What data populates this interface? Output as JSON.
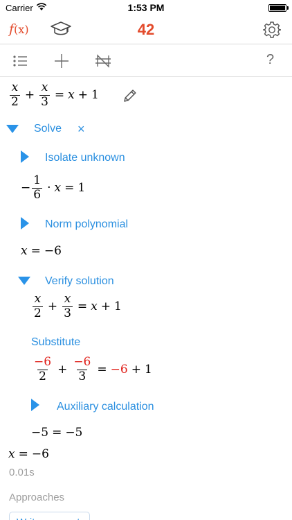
{
  "status_bar": {
    "carrier": "Carrier",
    "time": "1:53 PM"
  },
  "nav": {
    "fx_label": "f",
    "fx_arg": "(x)",
    "count": "42"
  },
  "toolbar": {
    "help": "?"
  },
  "equation": {
    "a": "x",
    "b": "2",
    "plus": "+",
    "c": "x",
    "d": "3",
    "eq": "=",
    "rhs_x": "x",
    "rhs_plus": "+",
    "rhs_1": "1"
  },
  "solve": {
    "label": "Solve",
    "close": "×"
  },
  "isolate": {
    "label": "Isolate unknown",
    "minus": "−",
    "num": "1",
    "den": "6",
    "dot": "·",
    "x": "x",
    "eq": "=",
    "one": "1"
  },
  "norm": {
    "label": "Norm polynomial",
    "x": "x",
    "eq": "=",
    "val": "−6"
  },
  "verify": {
    "label": "Verify solution",
    "eq": {
      "a": "x",
      "b": "2",
      "plus": "+",
      "c": "x",
      "d": "3",
      "eq": "=",
      "rhs_x": "x",
      "rhs_plus": "+",
      "rhs_1": "1"
    }
  },
  "substitute": {
    "label": "Substitute",
    "a": "−6",
    "b": "2",
    "plus": "+",
    "c": "−6",
    "d": "3",
    "eq": "=",
    "rhs_v": "−6",
    "rhs_plus": "+",
    "rhs_1": "1"
  },
  "aux": {
    "label": "Auxiliary calculation",
    "lhs": "−5",
    "eq": "=",
    "rhs": "−5"
  },
  "result": {
    "x": "x",
    "eq": "=",
    "val": "−6",
    "time": "0.01s"
  },
  "approaches": {
    "heading": "Approaches",
    "button": "Write as a set"
  },
  "colors": {
    "accent": "#2a8fe0",
    "brand": "#e34b2c",
    "highlight": "#e0201a"
  },
  "icons": [
    "wifi-icon",
    "battery-icon",
    "graduation-cap-icon",
    "gear-icon",
    "list-icon",
    "plus-icon",
    "not-equal-icon",
    "pencil-icon"
  ]
}
